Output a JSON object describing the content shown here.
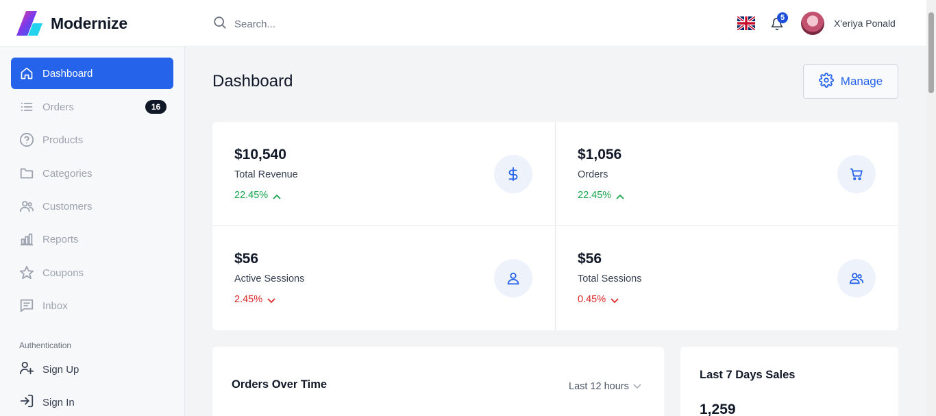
{
  "brand": {
    "name": "Modernize"
  },
  "search": {
    "placeholder": "Search..."
  },
  "header": {
    "notifications_count": "5",
    "user_name": "X'eriya Ponald"
  },
  "sidebar": {
    "items": [
      {
        "label": "Dashboard",
        "icon": "home-icon",
        "active": true
      },
      {
        "label": "Orders",
        "icon": "list-icon",
        "badge": "16"
      },
      {
        "label": "Products",
        "icon": "question-circle-icon"
      },
      {
        "label": "Categories",
        "icon": "folder-icon"
      },
      {
        "label": "Customers",
        "icon": "users-icon"
      },
      {
        "label": "Reports",
        "icon": "bar-chart-icon"
      },
      {
        "label": "Coupons",
        "icon": "star-icon"
      },
      {
        "label": "Inbox",
        "icon": "message-icon"
      }
    ],
    "section_label": "Authentication",
    "auth_items": [
      {
        "label": "Sign Up",
        "icon": "user-plus-icon"
      },
      {
        "label": "Sign In",
        "icon": "sign-in-icon"
      }
    ]
  },
  "main": {
    "title": "Dashboard",
    "manage_label": "Manage",
    "stats": [
      {
        "value": "$10,540",
        "label": "Total Revenue",
        "delta": "22.45%",
        "trend": "up",
        "icon": "dollar-icon"
      },
      {
        "value": "$1,056",
        "label": "Orders",
        "delta": "22.45%",
        "trend": "up",
        "icon": "cart-icon"
      },
      {
        "value": "$56",
        "label": "Active Sessions",
        "delta": "2.45%",
        "trend": "down",
        "icon": "user-icon"
      },
      {
        "value": "$56",
        "label": "Total Sessions",
        "delta": "0.45%",
        "trend": "down",
        "icon": "users-icon"
      }
    ],
    "orders_card": {
      "title": "Orders Over Time",
      "range": "Last 12 hours"
    },
    "sales_card": {
      "title": "Last 7 Days Sales",
      "value": "1,259"
    }
  },
  "colors": {
    "accent": "#2563eb",
    "up": "#16a34a",
    "down": "#dc2626"
  }
}
